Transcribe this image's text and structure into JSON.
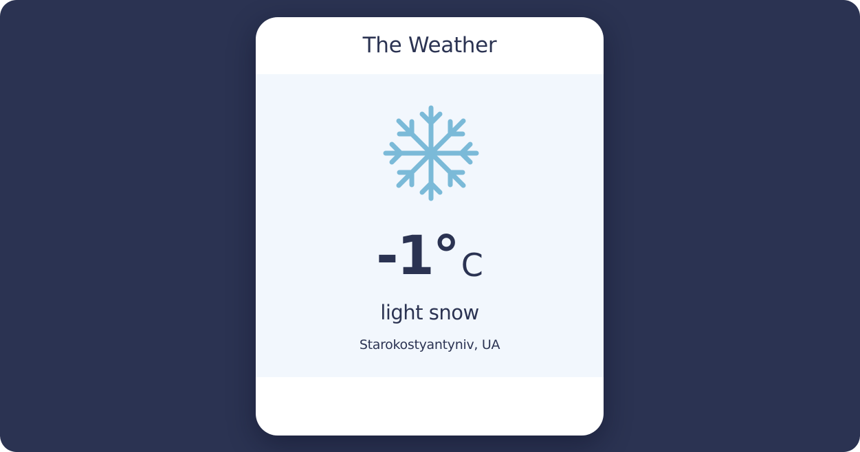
{
  "card": {
    "title": "The Weather"
  },
  "weather": {
    "icon": "snowflake-icon",
    "temperature": "-1°",
    "unit": "C",
    "condition": "light snow",
    "location": "Starokostyantyniv, UA"
  },
  "colors": {
    "background": "#2b3352",
    "card": "#ffffff",
    "panel": "#f2f7fd",
    "text": "#2b3352",
    "icon": "#7bbad8"
  }
}
